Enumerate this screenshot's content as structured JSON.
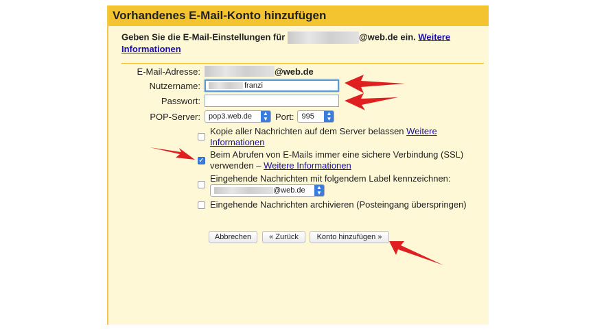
{
  "dialog": {
    "title": "Vorhandenes E-Mail-Konto hinzufügen",
    "intro_text": "Geben Sie die E-Mail-Einstellungen für",
    "intro_domain": "@web.de ein.",
    "intro_link": "Weitere Informationen"
  },
  "form": {
    "email_label": "E-Mail-Adresse:",
    "email_domain": "@web.de",
    "username_label": "Nutzername:",
    "username_value": "franzi",
    "password_label": "Passwort:",
    "password_value": "",
    "pop_label": "POP-Server:",
    "pop_value": "pop3.web.de",
    "port_label": "Port:",
    "port_value": "995"
  },
  "options": [
    {
      "text": "Kopie aller Nachrichten auf dem Server belassen",
      "link": "Weitere Informationen",
      "checked": false
    },
    {
      "text": "Beim Abrufen von E-Mails immer eine sichere Verbindung (SSL) verwenden –",
      "link": "Weitere Informationen",
      "checked": true
    },
    {
      "text": "Eingehende Nachrichten mit folgendem Label kennzeichnen:",
      "label_select_value": "@web.de",
      "checked": false
    },
    {
      "text": "Eingehende Nachrichten archivieren (Posteingang überspringen)",
      "checked": false
    }
  ],
  "buttons": {
    "cancel": "Abbrechen",
    "back": "« Zurück",
    "add": "Konto hinzufügen »"
  },
  "colors": {
    "title_bar": "#f4c430",
    "dialog_bg": "#fff8d6",
    "link": "#1a0dab",
    "annotation_arrow": "#e02020"
  }
}
